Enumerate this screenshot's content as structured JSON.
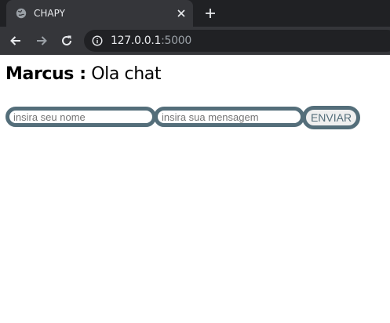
{
  "browser": {
    "tab": {
      "title": "CHAPY",
      "favicon": "globe-icon"
    },
    "address": {
      "host": "127.0.0.1",
      "port": ":5000"
    },
    "icons": {
      "back": "arrow-left-icon",
      "forward": "arrow-right-icon",
      "reload": "reload-icon",
      "info": "info-icon",
      "close": "close-icon",
      "new_tab": "plus-icon"
    },
    "colors": {
      "chrome_dark": "#202124",
      "chrome": "#35363a",
      "text": "#e8eaed",
      "muted": "#9aa0a6"
    }
  },
  "chat": {
    "messages": [
      {
        "author": "Marcus :",
        "text": " Ola chat"
      }
    ],
    "form": {
      "name_placeholder": "insira seu nome",
      "message_placeholder": "insira sua mensagem",
      "send_label": "ENVIAR"
    },
    "colors": {
      "accent": "#546e7a"
    }
  }
}
